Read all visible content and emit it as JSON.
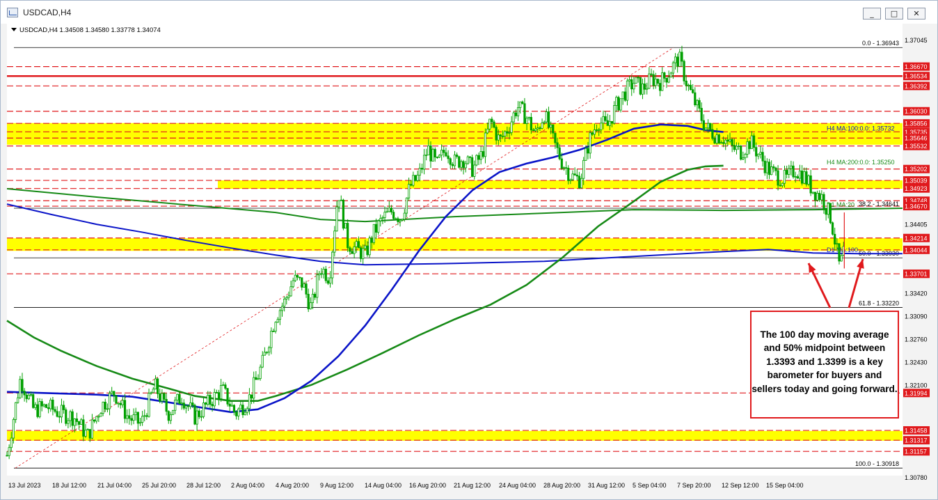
{
  "window": {
    "title": "USDCAD,H4",
    "min_button": "_",
    "max_button": "□",
    "close_button": "✕"
  },
  "chart_header": "USDCAD,H4  1.34508 1.34580 1.33778 1.34074",
  "colors": {
    "bg": "#ffffff",
    "candle": "#00a000",
    "zone": "#ffff00",
    "resistance": "#e0191c",
    "ma100": "#0a14c8",
    "ma200": "#168a16",
    "fib": "#000000"
  },
  "annotation": {
    "text": "The 100 day moving average and 50% midpoint between 1.3393 and 1.3399 is a key barometer for buyers and sellers today and going forward."
  },
  "chart_data": {
    "type": "candlestick",
    "symbol": "USDCAD",
    "timeframe": "H4",
    "ohlc_last": {
      "open": 1.34508,
      "high": 1.3458,
      "low": 1.33778,
      "close": 1.34074
    },
    "ylim": [
      1.3078,
      1.37045
    ],
    "y_ticks": [
      1.37045,
      1.34405,
      1.3342,
      1.3309,
      1.3276,
      1.3243,
      1.321,
      1.3078
    ],
    "x_ticks": [
      "13 Jul 2023",
      "18 Jul 12:00",
      "21 Jul 04:00",
      "25 Jul 20:00",
      "28 Jul 12:00",
      "2 Aug 04:00",
      "4 Aug 20:00",
      "9 Aug 12:00",
      "14 Aug 04:00",
      "16 Aug 20:00",
      "21 Aug 12:00",
      "24 Aug 04:00",
      "28 Aug 20:00",
      "31 Aug 12:00",
      "5 Sep 04:00",
      "7 Sep 20:00",
      "12 Sep 12:00",
      "15 Sep 04:00"
    ],
    "solid_levels": [
      {
        "value": 1.36534,
        "label": "1.36534"
      }
    ],
    "dashed_levels": [
      {
        "value": 1.3667,
        "label": "1.36670"
      },
      {
        "value": 1.36392,
        "label": "1.36392"
      },
      {
        "value": 1.3603,
        "label": "1.36030"
      },
      {
        "value": 1.35856,
        "label": "1.35856"
      },
      {
        "value": 1.35735,
        "label": "1.35735"
      },
      {
        "value": 1.35646,
        "label": "1.35646"
      },
      {
        "value": 1.35532,
        "label": "1.35532"
      },
      {
        "value": 1.35202,
        "label": "1.35202"
      },
      {
        "value": 1.35039,
        "label": "1.35039"
      },
      {
        "value": 1.34923,
        "label": "1.34923"
      },
      {
        "value": 1.34748,
        "label": "1.34748"
      },
      {
        "value": 1.3467,
        "label": "1.34670"
      },
      {
        "value": 1.34214,
        "label": "1.34214"
      },
      {
        "value": 1.34044,
        "label": "1.34044"
      },
      {
        "value": 1.33701,
        "label": "1.33701"
      },
      {
        "value": 1.31994,
        "label": "1.31994"
      },
      {
        "value": 1.31458,
        "label": "1.31458"
      },
      {
        "value": 1.31317,
        "label": "1.31317"
      },
      {
        "value": 1.31157,
        "label": "1.31157"
      }
    ],
    "zones": [
      {
        "from": 1.3555,
        "to": 1.3586
      },
      {
        "from": 1.3492,
        "to": 1.3504
      },
      {
        "from": 1.3403,
        "to": 1.3421
      },
      {
        "from": 1.3131,
        "to": 1.3145
      }
    ],
    "fib_levels": [
      {
        "value": 1.36943,
        "label": "0.0 - 1.36943"
      },
      {
        "value": 1.34641,
        "label": "38.2 - 1.34641"
      },
      {
        "value": 1.3393,
        "label": "50.0 - 1.33930"
      },
      {
        "value": 1.3322,
        "label": "61.8 - 1.33220"
      },
      {
        "value": 1.30918,
        "label": "100.0 - 1.30918"
      }
    ],
    "ma_labels": [
      {
        "text": "H4 MA:100:0.0: 1.35732",
        "value": 1.35732
      },
      {
        "text": "H4 MA:200:0.0: 1.35250",
        "value": 1.3525
      },
      {
        "text": "D1 MA:20",
        "value": 1.34641
      },
      {
        "text": "D1 MA:100",
        "value": 1.3399
      }
    ],
    "h4_ma100": [
      [
        0.0,
        1.3201
      ],
      [
        0.05,
        1.3199
      ],
      [
        0.1,
        1.3197
      ],
      [
        0.14,
        1.3194
      ],
      [
        0.18,
        1.3186
      ],
      [
        0.22,
        1.3178
      ],
      [
        0.25,
        1.3172
      ],
      [
        0.28,
        1.3176
      ],
      [
        0.31,
        1.3192
      ],
      [
        0.34,
        1.3217
      ],
      [
        0.37,
        1.3252
      ],
      [
        0.4,
        1.3296
      ],
      [
        0.43,
        1.3348
      ],
      [
        0.46,
        1.3403
      ],
      [
        0.49,
        1.3452
      ],
      [
        0.52,
        1.349
      ],
      [
        0.55,
        1.3516
      ],
      [
        0.58,
        1.3528
      ],
      [
        0.61,
        1.3537
      ],
      [
        0.64,
        1.3548
      ],
      [
        0.67,
        1.3562
      ],
      [
        0.7,
        1.3578
      ],
      [
        0.73,
        1.3584
      ],
      [
        0.76,
        1.3582
      ],
      [
        0.78,
        1.3576
      ],
      [
        0.8,
        1.35732
      ]
    ],
    "h4_ma200": [
      [
        0.0,
        1.3303
      ],
      [
        0.03,
        1.3279
      ],
      [
        0.06,
        1.326
      ],
      [
        0.1,
        1.3238
      ],
      [
        0.14,
        1.322
      ],
      [
        0.18,
        1.3206
      ],
      [
        0.21,
        1.3195
      ],
      [
        0.25,
        1.3188
      ],
      [
        0.28,
        1.3188
      ],
      [
        0.3,
        1.3195
      ],
      [
        0.34,
        1.3211
      ],
      [
        0.38,
        1.3233
      ],
      [
        0.42,
        1.3257
      ],
      [
        0.46,
        1.3282
      ],
      [
        0.5,
        1.3305
      ],
      [
        0.54,
        1.3326
      ],
      [
        0.58,
        1.3354
      ],
      [
        0.62,
        1.3393
      ],
      [
        0.66,
        1.3438
      ],
      [
        0.7,
        1.3474
      ],
      [
        0.73,
        1.3502
      ],
      [
        0.76,
        1.3519
      ],
      [
        0.78,
        1.3524
      ],
      [
        0.8,
        1.3525
      ]
    ],
    "d1_ma20": [
      [
        0.0,
        1.3492
      ],
      [
        0.1,
        1.348
      ],
      [
        0.2,
        1.3469
      ],
      [
        0.3,
        1.3458
      ],
      [
        0.35,
        1.3448
      ],
      [
        0.4,
        1.3445
      ],
      [
        0.5,
        1.3452
      ],
      [
        0.6,
        1.3457
      ],
      [
        0.7,
        1.3462
      ],
      [
        0.8,
        1.3461
      ],
      [
        0.9,
        1.3462
      ],
      [
        0.95,
        1.3463
      ],
      [
        1.0,
        1.34641
      ]
    ],
    "d1_ma100": [
      [
        0.0,
        1.347
      ],
      [
        0.05,
        1.3455
      ],
      [
        0.1,
        1.3441
      ],
      [
        0.15,
        1.343
      ],
      [
        0.2,
        1.3418
      ],
      [
        0.25,
        1.3407
      ],
      [
        0.3,
        1.3397
      ],
      [
        0.35,
        1.3388
      ],
      [
        0.4,
        1.3383
      ],
      [
        0.5,
        1.3385
      ],
      [
        0.6,
        1.3388
      ],
      [
        0.7,
        1.3395
      ],
      [
        0.8,
        1.3402
      ],
      [
        0.85,
        1.3405
      ],
      [
        0.9,
        1.34
      ],
      [
        0.95,
        1.3399
      ],
      [
        1.0,
        1.3399
      ]
    ],
    "path": [
      [
        0.0,
        1.311
      ],
      [
        0.015,
        1.322
      ],
      [
        0.03,
        1.3175
      ],
      [
        0.045,
        1.318
      ],
      [
        0.06,
        1.317
      ],
      [
        0.075,
        1.3165
      ],
      [
        0.09,
        1.3138
      ],
      [
        0.105,
        1.318
      ],
      [
        0.12,
        1.32
      ],
      [
        0.135,
        1.3165
      ],
      [
        0.15,
        1.3155
      ],
      [
        0.165,
        1.321
      ],
      [
        0.18,
        1.317
      ],
      [
        0.195,
        1.3195
      ],
      [
        0.21,
        1.3165
      ],
      [
        0.225,
        1.3185
      ],
      [
        0.24,
        1.3205
      ],
      [
        0.255,
        1.317
      ],
      [
        0.27,
        1.319
      ],
      [
        0.285,
        1.324
      ],
      [
        0.3,
        1.331
      ],
      [
        0.31,
        1.333
      ],
      [
        0.32,
        1.3362
      ],
      [
        0.33,
        1.3356
      ],
      [
        0.34,
        1.332
      ],
      [
        0.35,
        1.338
      ],
      [
        0.36,
        1.3365
      ],
      [
        0.37,
        1.349
      ],
      [
        0.38,
        1.3415
      ],
      [
        0.39,
        1.3405
      ],
      [
        0.4,
        1.3398
      ],
      [
        0.41,
        1.343
      ],
      [
        0.42,
        1.345
      ],
      [
        0.43,
        1.346
      ],
      [
        0.44,
        1.345
      ],
      [
        0.45,
        1.3495
      ],
      [
        0.46,
        1.351
      ],
      [
        0.47,
        1.355
      ],
      [
        0.48,
        1.3525
      ],
      [
        0.49,
        1.355
      ],
      [
        0.5,
        1.353
      ],
      [
        0.51,
        1.3535
      ],
      [
        0.52,
        1.352
      ],
      [
        0.53,
        1.354
      ],
      [
        0.54,
        1.359
      ],
      [
        0.55,
        1.356
      ],
      [
        0.56,
        1.358
      ],
      [
        0.57,
        1.361
      ],
      [
        0.58,
        1.3595
      ],
      [
        0.59,
        1.357
      ],
      [
        0.6,
        1.36
      ],
      [
        0.61,
        1.356
      ],
      [
        0.62,
        1.353
      ],
      [
        0.63,
        1.351
      ],
      [
        0.64,
        1.3505
      ],
      [
        0.65,
        1.356
      ],
      [
        0.66,
        1.359
      ],
      [
        0.67,
        1.358
      ],
      [
        0.68,
        1.361
      ],
      [
        0.69,
        1.363
      ],
      [
        0.7,
        1.3645
      ],
      [
        0.71,
        1.3635
      ],
      [
        0.72,
        1.365
      ],
      [
        0.73,
        1.3645
      ],
      [
        0.74,
        1.366
      ],
      [
        0.75,
        1.368
      ],
      [
        0.76,
        1.364
      ],
      [
        0.77,
        1.361
      ],
      [
        0.78,
        1.358
      ],
      [
        0.79,
        1.357
      ],
      [
        0.8,
        1.3565
      ],
      [
        0.81,
        1.355
      ],
      [
        0.82,
        1.3545
      ],
      [
        0.83,
        1.356
      ],
      [
        0.84,
        1.354
      ],
      [
        0.85,
        1.352
      ],
      [
        0.86,
        1.351
      ],
      [
        0.87,
        1.3505
      ],
      [
        0.88,
        1.352
      ],
      [
        0.89,
        1.351
      ],
      [
        0.9,
        1.349
      ],
      [
        0.91,
        1.348
      ],
      [
        0.92,
        1.345
      ],
      [
        0.93,
        1.3378
      ],
      [
        0.935,
        1.34074
      ]
    ]
  }
}
